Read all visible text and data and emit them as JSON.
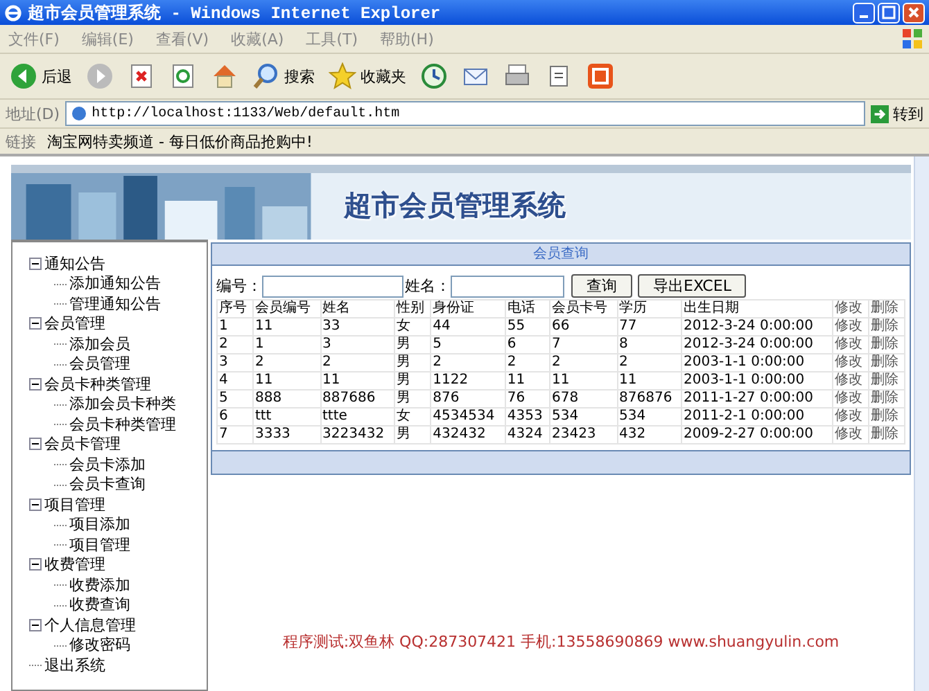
{
  "window": {
    "title": "超市会员管理系统 - Windows Internet Explorer"
  },
  "menu": [
    "文件(F)",
    "编辑(E)",
    "查看(V)",
    "收藏(A)",
    "工具(T)",
    "帮助(H)"
  ],
  "toolbar": [
    {
      "kind": "back",
      "label": "后退"
    },
    {
      "kind": "forward"
    },
    {
      "kind": "stop"
    },
    {
      "kind": "refresh"
    },
    {
      "kind": "home"
    },
    {
      "kind": "search",
      "label": "搜索"
    },
    {
      "kind": "favorites",
      "label": "收藏夹"
    },
    {
      "kind": "history"
    },
    {
      "kind": "mail"
    },
    {
      "kind": "print"
    },
    {
      "kind": "edit"
    },
    {
      "kind": "taobao"
    }
  ],
  "address_bar": {
    "label": "地址(D)",
    "value": "http://localhost:1133/Web/default.htm",
    "go": "转到"
  },
  "links_bar": {
    "label": "链接",
    "link": "淘宝网特卖频道 - 每日低价商品抢购中!"
  },
  "banner": {
    "title": "超市会员管理系统"
  },
  "tree": [
    {
      "label": "通知公告",
      "expanded": true,
      "children": [
        {
          "label": "添加通知公告"
        },
        {
          "label": "管理通知公告"
        }
      ]
    },
    {
      "label": "会员管理",
      "expanded": true,
      "children": [
        {
          "label": "添加会员"
        },
        {
          "label": "会员管理"
        }
      ]
    },
    {
      "label": "会员卡种类管理",
      "expanded": true,
      "children": [
        {
          "label": "添加会员卡种类"
        },
        {
          "label": "会员卡种类管理"
        }
      ]
    },
    {
      "label": "会员卡管理",
      "expanded": true,
      "children": [
        {
          "label": "会员卡添加"
        },
        {
          "label": "会员卡查询"
        }
      ]
    },
    {
      "label": "项目管理",
      "expanded": true,
      "children": [
        {
          "label": "项目添加"
        },
        {
          "label": "项目管理"
        }
      ]
    },
    {
      "label": "收费管理",
      "expanded": true,
      "children": [
        {
          "label": "收费添加"
        },
        {
          "label": "收费查询"
        }
      ]
    },
    {
      "label": "个人信息管理",
      "expanded": true,
      "children": [
        {
          "label": "修改密码"
        }
      ]
    },
    {
      "label": "退出系统"
    }
  ],
  "panel": {
    "title": "会员查询",
    "fields": [
      {
        "label": "编号："
      },
      {
        "label": "姓名："
      }
    ],
    "buttons": [
      "查询",
      "导出EXCEL"
    ]
  },
  "table": {
    "columns": [
      "序号",
      "会员编号",
      "姓名",
      "性别",
      "身份证",
      "电话",
      "会员卡号",
      "学历",
      "出生日期",
      "修改",
      "删除"
    ],
    "rows": [
      [
        "1",
        "11",
        "33",
        "女",
        "44",
        "55",
        "66",
        "77",
        "2012-3-24 0:00:00",
        "修改",
        "删除"
      ],
      [
        "2",
        "1",
        "3",
        "男",
        "5",
        "6",
        "7",
        "8",
        "2012-3-24 0:00:00",
        "修改",
        "删除"
      ],
      [
        "3",
        "2",
        "2",
        "男",
        "2",
        "2",
        "2",
        "2",
        "2003-1-1 0:00:00",
        "修改",
        "删除"
      ],
      [
        "4",
        "11",
        "11",
        "男",
        "1122",
        "11",
        "11",
        "11",
        "2003-1-1 0:00:00",
        "修改",
        "删除"
      ],
      [
        "5",
        "888",
        "887686",
        "男",
        "876",
        "76",
        "678",
        "876876",
        "2011-1-27 0:00:00",
        "修改",
        "删除"
      ],
      [
        "6",
        "ttt",
        "ttte",
        "女",
        "4534534",
        "4353",
        "534",
        "534",
        "2011-2-1 0:00:00",
        "修改",
        "删除"
      ],
      [
        "7",
        "3333",
        "3223432",
        "男",
        "432432",
        "4324",
        "23423",
        "432",
        "2009-2-27 0:00:00",
        "修改",
        "删除"
      ]
    ]
  },
  "footer": "程序测试:双鱼林 QQ:287307421 手机:13558690869 www.shuangyulin.com"
}
